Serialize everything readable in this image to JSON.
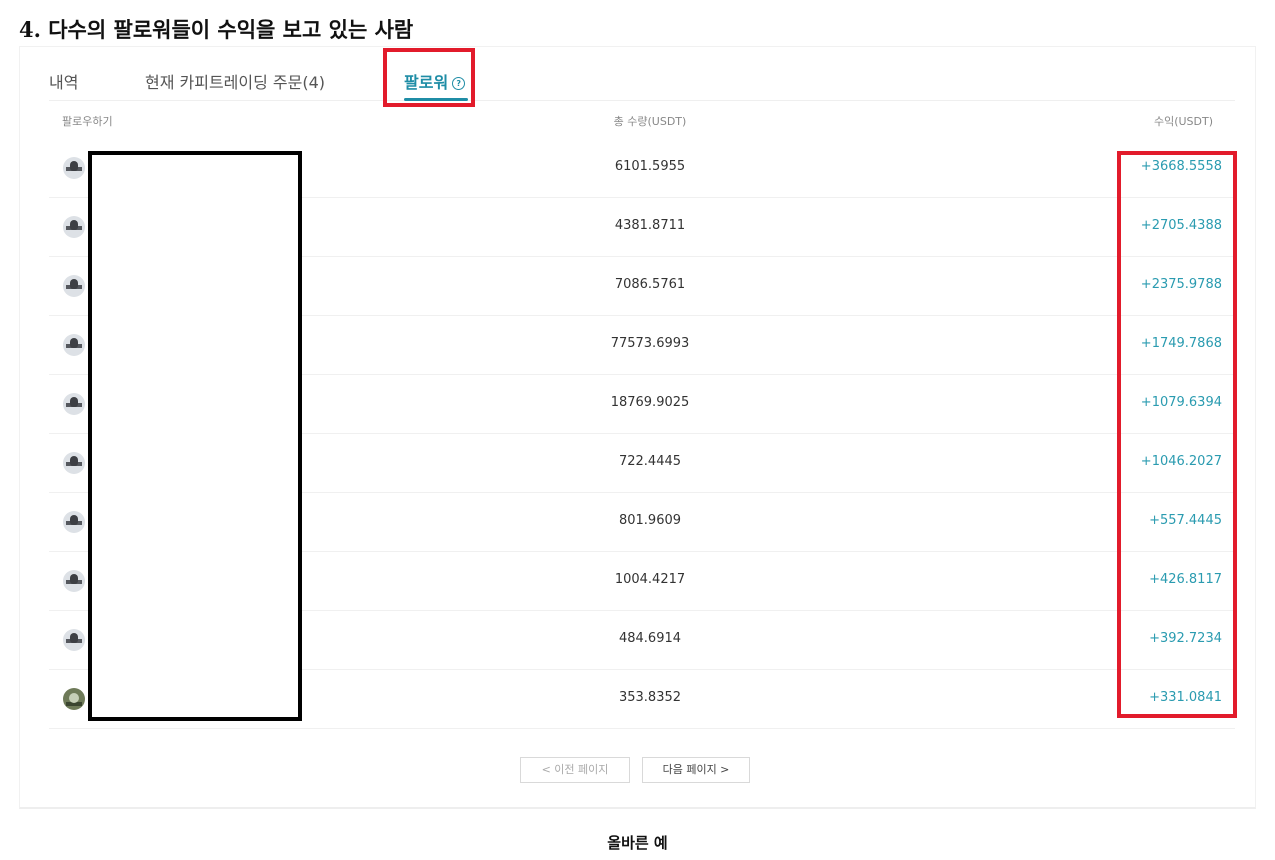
{
  "heading": "4. 다수의 팔로워들이 수익을 보고 있는 사람",
  "tabs": [
    {
      "label": "내역"
    },
    {
      "label": "현재 카피트레이딩 주문(4)"
    },
    {
      "label": "팔로워",
      "active": true
    }
  ],
  "help_icon": {
    "icon": "question-circle-icon",
    "glyph": "?"
  },
  "columns": {
    "follower": "팔로우하기",
    "quantity": "총 수량(USDT)",
    "profit": "수익(USDT)"
  },
  "rows": [
    {
      "quantity": "6101.5955",
      "profit": "+3668.5558"
    },
    {
      "quantity": "4381.8711",
      "profit": "+2705.4388"
    },
    {
      "quantity": "7086.5761",
      "profit": "+2375.9788"
    },
    {
      "quantity": "77573.6993",
      "profit": "+1749.7868"
    },
    {
      "quantity": "18769.9025",
      "profit": "+1079.6394"
    },
    {
      "quantity": "722.4445",
      "profit": "+1046.2027"
    },
    {
      "quantity": "801.9609",
      "profit": "+557.4445"
    },
    {
      "quantity": "1004.4217",
      "profit": "+426.8117"
    },
    {
      "quantity": "484.6914",
      "profit": "+392.7234"
    },
    {
      "quantity": "353.8352",
      "profit": "+331.0841"
    }
  ],
  "pagination": {
    "prev": "< 이전 페이지",
    "next": "다음 페이지 >"
  },
  "caption": "올바른 예",
  "colors": {
    "accent": "#1f8da6",
    "profit": "#2a9bb0",
    "highlight": "#e21b2b"
  }
}
